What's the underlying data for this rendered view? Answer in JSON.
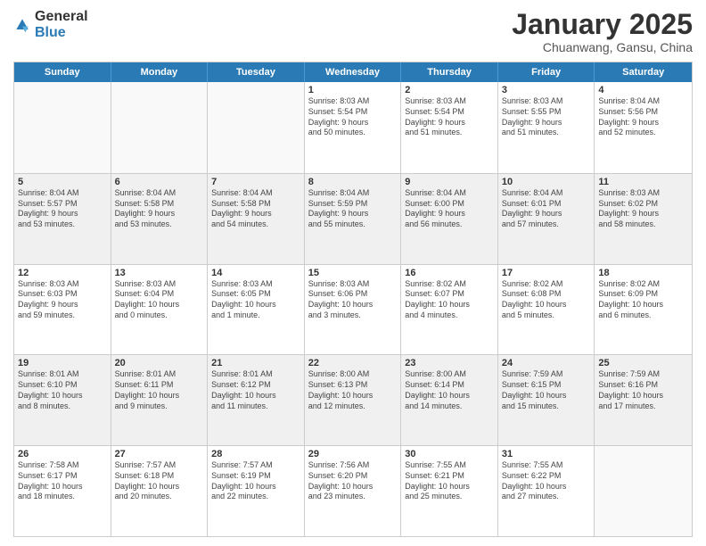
{
  "logo": {
    "general": "General",
    "blue": "Blue"
  },
  "header": {
    "title": "January 2025",
    "subtitle": "Chuanwang, Gansu, China"
  },
  "weekdays": [
    "Sunday",
    "Monday",
    "Tuesday",
    "Wednesday",
    "Thursday",
    "Friday",
    "Saturday"
  ],
  "weeks": [
    [
      {
        "day": "",
        "detail": "",
        "empty": true
      },
      {
        "day": "",
        "detail": "",
        "empty": true
      },
      {
        "day": "",
        "detail": "",
        "empty": true
      },
      {
        "day": "1",
        "detail": "Sunrise: 8:03 AM\nSunset: 5:54 PM\nDaylight: 9 hours\nand 50 minutes."
      },
      {
        "day": "2",
        "detail": "Sunrise: 8:03 AM\nSunset: 5:54 PM\nDaylight: 9 hours\nand 51 minutes."
      },
      {
        "day": "3",
        "detail": "Sunrise: 8:03 AM\nSunset: 5:55 PM\nDaylight: 9 hours\nand 51 minutes."
      },
      {
        "day": "4",
        "detail": "Sunrise: 8:04 AM\nSunset: 5:56 PM\nDaylight: 9 hours\nand 52 minutes."
      }
    ],
    [
      {
        "day": "5",
        "detail": "Sunrise: 8:04 AM\nSunset: 5:57 PM\nDaylight: 9 hours\nand 53 minutes."
      },
      {
        "day": "6",
        "detail": "Sunrise: 8:04 AM\nSunset: 5:58 PM\nDaylight: 9 hours\nand 53 minutes."
      },
      {
        "day": "7",
        "detail": "Sunrise: 8:04 AM\nSunset: 5:58 PM\nDaylight: 9 hours\nand 54 minutes."
      },
      {
        "day": "8",
        "detail": "Sunrise: 8:04 AM\nSunset: 5:59 PM\nDaylight: 9 hours\nand 55 minutes."
      },
      {
        "day": "9",
        "detail": "Sunrise: 8:04 AM\nSunset: 6:00 PM\nDaylight: 9 hours\nand 56 minutes."
      },
      {
        "day": "10",
        "detail": "Sunrise: 8:04 AM\nSunset: 6:01 PM\nDaylight: 9 hours\nand 57 minutes."
      },
      {
        "day": "11",
        "detail": "Sunrise: 8:03 AM\nSunset: 6:02 PM\nDaylight: 9 hours\nand 58 minutes."
      }
    ],
    [
      {
        "day": "12",
        "detail": "Sunrise: 8:03 AM\nSunset: 6:03 PM\nDaylight: 9 hours\nand 59 minutes."
      },
      {
        "day": "13",
        "detail": "Sunrise: 8:03 AM\nSunset: 6:04 PM\nDaylight: 10 hours\nand 0 minutes."
      },
      {
        "day": "14",
        "detail": "Sunrise: 8:03 AM\nSunset: 6:05 PM\nDaylight: 10 hours\nand 1 minute."
      },
      {
        "day": "15",
        "detail": "Sunrise: 8:03 AM\nSunset: 6:06 PM\nDaylight: 10 hours\nand 3 minutes."
      },
      {
        "day": "16",
        "detail": "Sunrise: 8:02 AM\nSunset: 6:07 PM\nDaylight: 10 hours\nand 4 minutes."
      },
      {
        "day": "17",
        "detail": "Sunrise: 8:02 AM\nSunset: 6:08 PM\nDaylight: 10 hours\nand 5 minutes."
      },
      {
        "day": "18",
        "detail": "Sunrise: 8:02 AM\nSunset: 6:09 PM\nDaylight: 10 hours\nand 6 minutes."
      }
    ],
    [
      {
        "day": "19",
        "detail": "Sunrise: 8:01 AM\nSunset: 6:10 PM\nDaylight: 10 hours\nand 8 minutes."
      },
      {
        "day": "20",
        "detail": "Sunrise: 8:01 AM\nSunset: 6:11 PM\nDaylight: 10 hours\nand 9 minutes."
      },
      {
        "day": "21",
        "detail": "Sunrise: 8:01 AM\nSunset: 6:12 PM\nDaylight: 10 hours\nand 11 minutes."
      },
      {
        "day": "22",
        "detail": "Sunrise: 8:00 AM\nSunset: 6:13 PM\nDaylight: 10 hours\nand 12 minutes."
      },
      {
        "day": "23",
        "detail": "Sunrise: 8:00 AM\nSunset: 6:14 PM\nDaylight: 10 hours\nand 14 minutes."
      },
      {
        "day": "24",
        "detail": "Sunrise: 7:59 AM\nSunset: 6:15 PM\nDaylight: 10 hours\nand 15 minutes."
      },
      {
        "day": "25",
        "detail": "Sunrise: 7:59 AM\nSunset: 6:16 PM\nDaylight: 10 hours\nand 17 minutes."
      }
    ],
    [
      {
        "day": "26",
        "detail": "Sunrise: 7:58 AM\nSunset: 6:17 PM\nDaylight: 10 hours\nand 18 minutes."
      },
      {
        "day": "27",
        "detail": "Sunrise: 7:57 AM\nSunset: 6:18 PM\nDaylight: 10 hours\nand 20 minutes."
      },
      {
        "day": "28",
        "detail": "Sunrise: 7:57 AM\nSunset: 6:19 PM\nDaylight: 10 hours\nand 22 minutes."
      },
      {
        "day": "29",
        "detail": "Sunrise: 7:56 AM\nSunset: 6:20 PM\nDaylight: 10 hours\nand 23 minutes."
      },
      {
        "day": "30",
        "detail": "Sunrise: 7:55 AM\nSunset: 6:21 PM\nDaylight: 10 hours\nand 25 minutes."
      },
      {
        "day": "31",
        "detail": "Sunrise: 7:55 AM\nSunset: 6:22 PM\nDaylight: 10 hours\nand 27 minutes."
      },
      {
        "day": "",
        "detail": "",
        "empty": true
      }
    ]
  ]
}
